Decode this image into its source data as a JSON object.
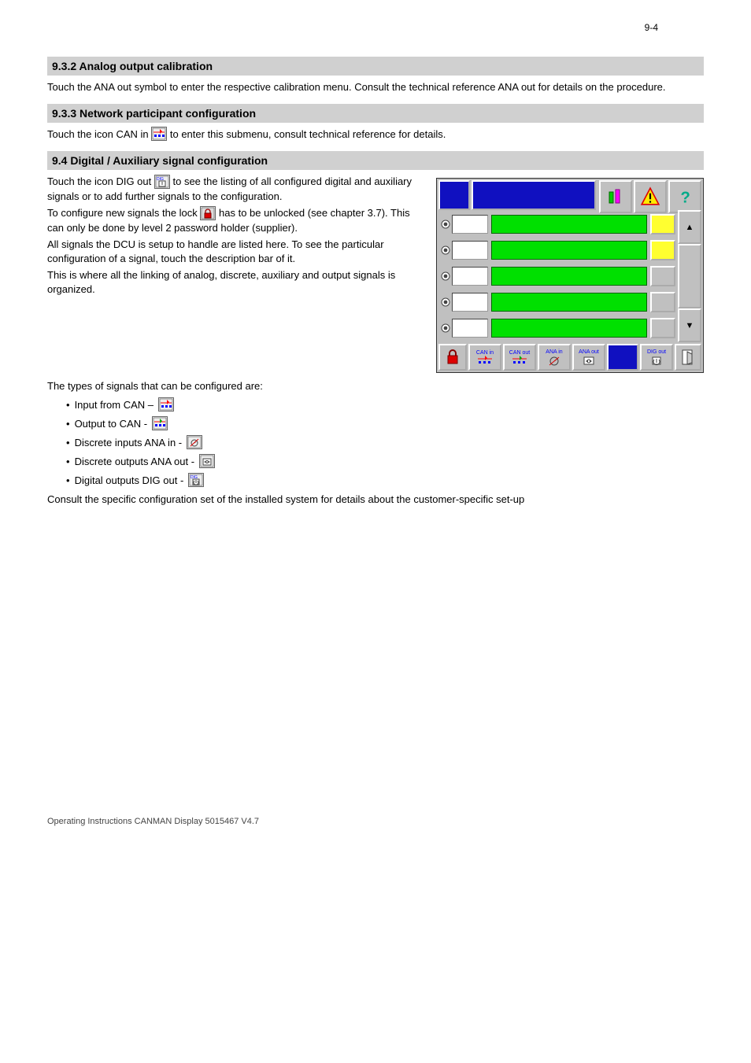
{
  "page": {
    "top_page_num": "9-4",
    "bottom_note": "Operating Instructions CANMAN Display 5015467 V4.7"
  },
  "sections": {
    "h1": "9.3.2 Analog output calibration",
    "h1_text": "Touch the ANA out symbol to enter the respective calibration menu. Consult the technical reference ANA out for details on the procedure.",
    "h2": "9.3.3 Network participant configuration",
    "h2_text_before_icon": "Touch the icon CAN in",
    "h2_text_after_icon": "to enter this submenu, consult technical reference for details.",
    "h3": "9.4 Digital / Auxiliary signal configuration",
    "dig_para1_before": "Touch the icon DIG out",
    "dig_para1_after": "to see the listing of all configured digital and auxiliary signals or to add further signals to the configuration.",
    "dig_para2_before": "To configure new signals the lock",
    "dig_para2_after": "has to be unlocked (see chapter 3.7). This can only be done by level 2 password holder (supplier).",
    "dig_para3": "All signals the DCU is setup to handle are listed here. To see the particular configuration of a signal, touch the description bar of it.",
    "dig_para4": "This is where all the linking of analog, discrete, auxiliary and output signals is organized."
  },
  "types": {
    "intro": "The types of signals that can be configured are:",
    "items": [
      {
        "label": "Input from CAN –"
      },
      {
        "label": "Output to CAN -"
      },
      {
        "label": "Discrete inputs ANA in -"
      },
      {
        "label": "Discrete outputs ANA out -"
      },
      {
        "label": "Digital outputs DIG out -"
      }
    ],
    "outro": "Consult the specific configuration set of the installed system for details about the customer-specific set-up"
  },
  "screenshot": {
    "up": "▲",
    "down": "▼",
    "footer_tabs": [
      "CAN in",
      "CAN out",
      "ANA in",
      "ANA out"
    ],
    "footer_digout": "DIG out"
  }
}
